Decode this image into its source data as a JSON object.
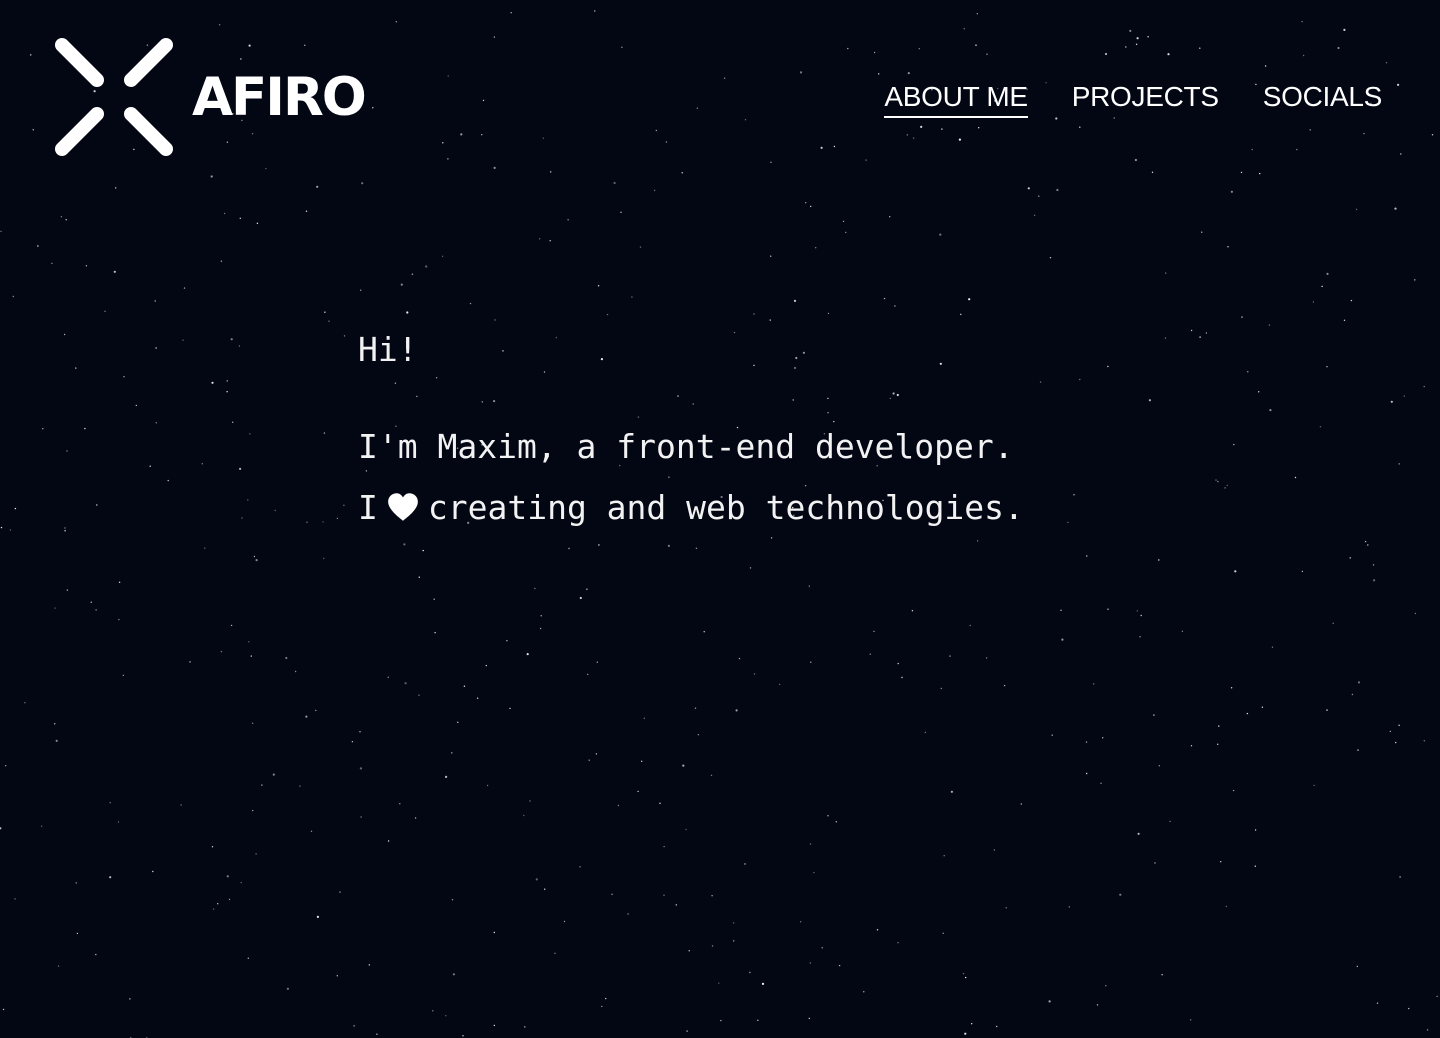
{
  "brand": {
    "name": "AFIRO",
    "logo_icon": "x-logo-icon"
  },
  "nav": {
    "items": [
      {
        "label": "ABOUT ME",
        "active": true
      },
      {
        "label": "PROJECTS",
        "active": false
      },
      {
        "label": "SOCIALS",
        "active": false
      }
    ]
  },
  "intro": {
    "greeting": "Hi!",
    "line1": "I'm Maxim, a front-end developer.",
    "line2_prefix": "I",
    "line2_icon": "heart-icon",
    "line2_suffix": "creating and web technologies."
  },
  "colors": {
    "background": "#030714",
    "text": "#ffffff",
    "stars": "#ffffff"
  }
}
